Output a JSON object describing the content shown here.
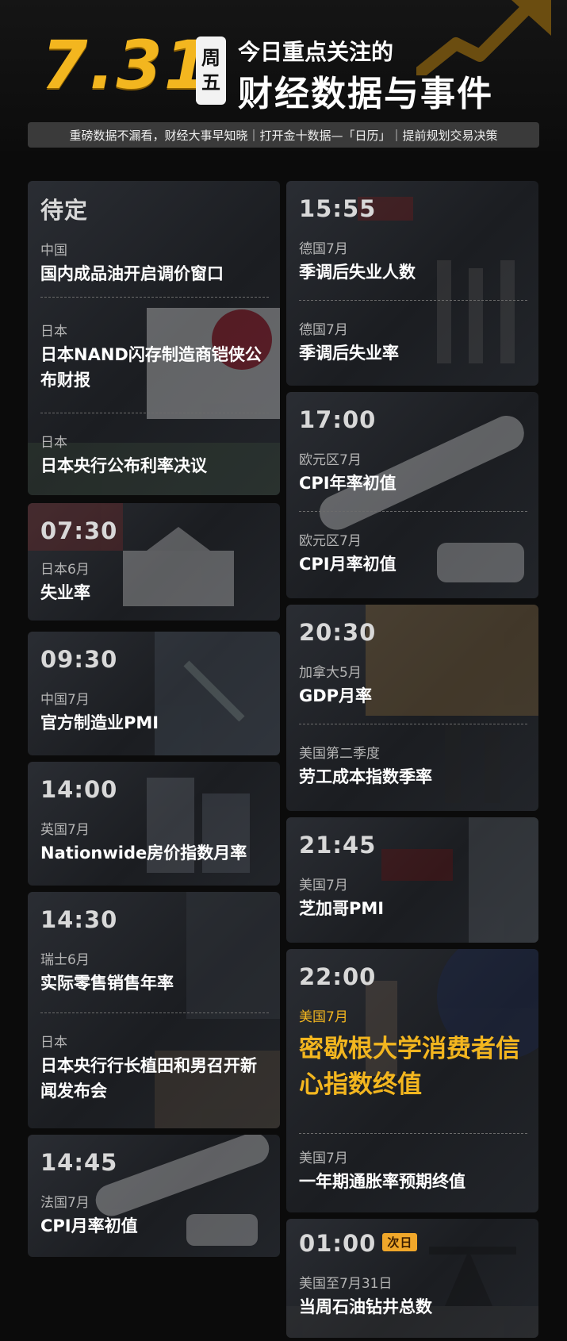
{
  "header": {
    "date": "7.31",
    "weekday": [
      "周",
      "五"
    ],
    "title_line1": "今日重点关注的",
    "title_line2": "财经数据与事件",
    "subtitle": "重磅数据不漏看，财经大事早知晓｜打开金十数据—「日历」｜提前规划交易决策"
  },
  "left": [
    {
      "time": "待定",
      "events": [
        {
          "region": "中国",
          "name": "国内成品油开启调价窗口"
        },
        {
          "region": "日本",
          "name": "日本NAND闪存制造商铠侠公布财报"
        },
        {
          "region": "日本",
          "name": "日本央行公布利率决议"
        }
      ]
    },
    {
      "time": "07:30",
      "events": [
        {
          "region": "日本6月",
          "name": "失业率"
        }
      ]
    },
    {
      "time": "09:30",
      "events": [
        {
          "region": "中国7月",
          "name": "官方制造业PMI"
        }
      ]
    },
    {
      "time": "14:00",
      "events": [
        {
          "region": "英国7月",
          "name": "Nationwide房价指数月率"
        }
      ]
    },
    {
      "time": "14:30",
      "events": [
        {
          "region": "瑞士6月",
          "name": "实际零售销售年率"
        },
        {
          "region": "日本",
          "name": "日本央行行长植田和男召开新闻发布会"
        }
      ]
    },
    {
      "time": "14:45",
      "events": [
        {
          "region": "法国7月",
          "name": "CPI月率初值"
        }
      ]
    }
  ],
  "right": [
    {
      "time": "15:55",
      "events": [
        {
          "region": "德国7月",
          "name": "季调后失业人数"
        },
        {
          "region": "德国7月",
          "name": "季调后失业率"
        }
      ]
    },
    {
      "time": "17:00",
      "events": [
        {
          "region": "欧元区7月",
          "name": "CPI年率初值"
        },
        {
          "region": "欧元区7月",
          "name": "CPI月率初值"
        }
      ]
    },
    {
      "time": "20:30",
      "events": [
        {
          "region": "加拿大5月",
          "name": "GDP月率"
        },
        {
          "region": "美国第二季度",
          "name": "劳工成本指数季率"
        }
      ]
    },
    {
      "time": "21:45",
      "events": [
        {
          "region": "美国7月",
          "name": "芝加哥PMI"
        }
      ]
    },
    {
      "time": "22:00",
      "events": [
        {
          "region": "美国7月",
          "name": "密歇根大学消费者信心指数终值"
        },
        {
          "region": "美国7月",
          "name": "一年期通胀率预期终值"
        }
      ]
    },
    {
      "time": "01:00",
      "tag": "次日",
      "events": [
        {
          "region": "美国至7月31日",
          "name": "当周石油钻井总数"
        }
      ]
    }
  ],
  "colors": {
    "accent": "#f3b61f",
    "background": "#0b0b0b",
    "card": "#23262b"
  }
}
